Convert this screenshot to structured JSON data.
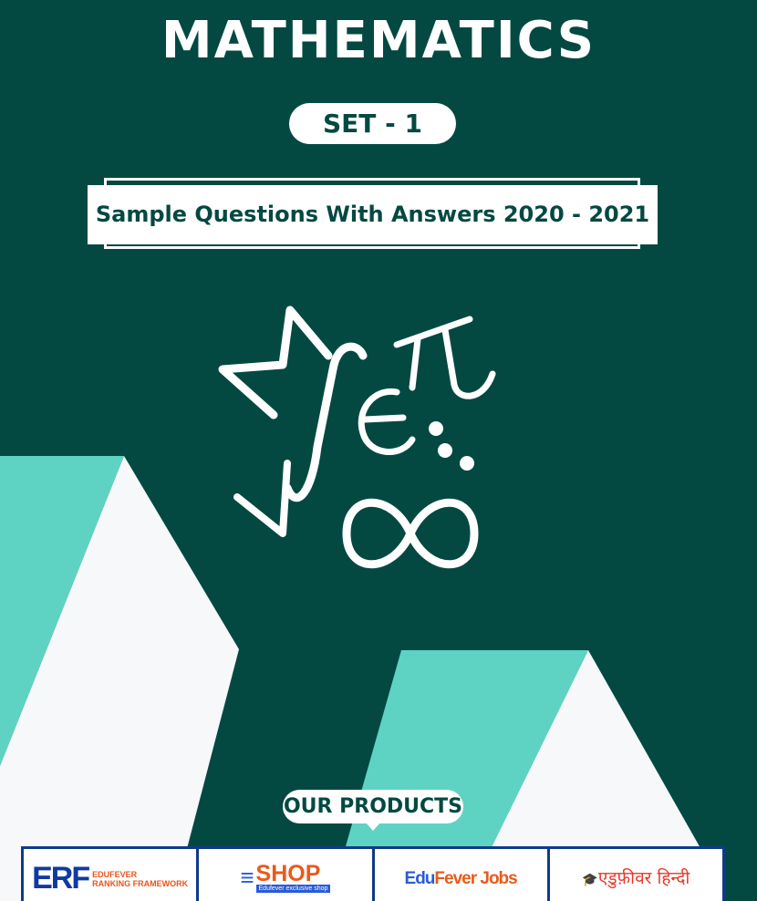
{
  "header": {
    "title": "MATHEMATICS",
    "set_label": "SET - 1",
    "subtitle": "Sample Questions With Answers 2020 - 2021"
  },
  "illustration": {
    "icon": "math-symbols-icon",
    "glyphs": "√ ∫ e π ∞"
  },
  "products": {
    "heading": "OUR PRODUCTS",
    "items": [
      {
        "logo_mark": "ERF",
        "line1": "EDUFEVER",
        "line2": "RANKING FRAMEWORK",
        "icon": "erf-logo-icon"
      },
      {
        "logo_mark": "SHOP",
        "tagline": "Edufever exclusive shop",
        "icon": "shop-logo-icon"
      },
      {
        "part1": "Edu",
        "part2": "Fever Jobs",
        "icon": "jobs-logo-icon"
      },
      {
        "text": "एडुफ़ीवर हिन्दी",
        "icon": "hindi-logo-icon"
      }
    ]
  },
  "colors": {
    "background": "#034942",
    "accent_teal": "#5ed3c3",
    "shape_white": "#f7f8fa",
    "product_border": "#0f3a8a"
  }
}
